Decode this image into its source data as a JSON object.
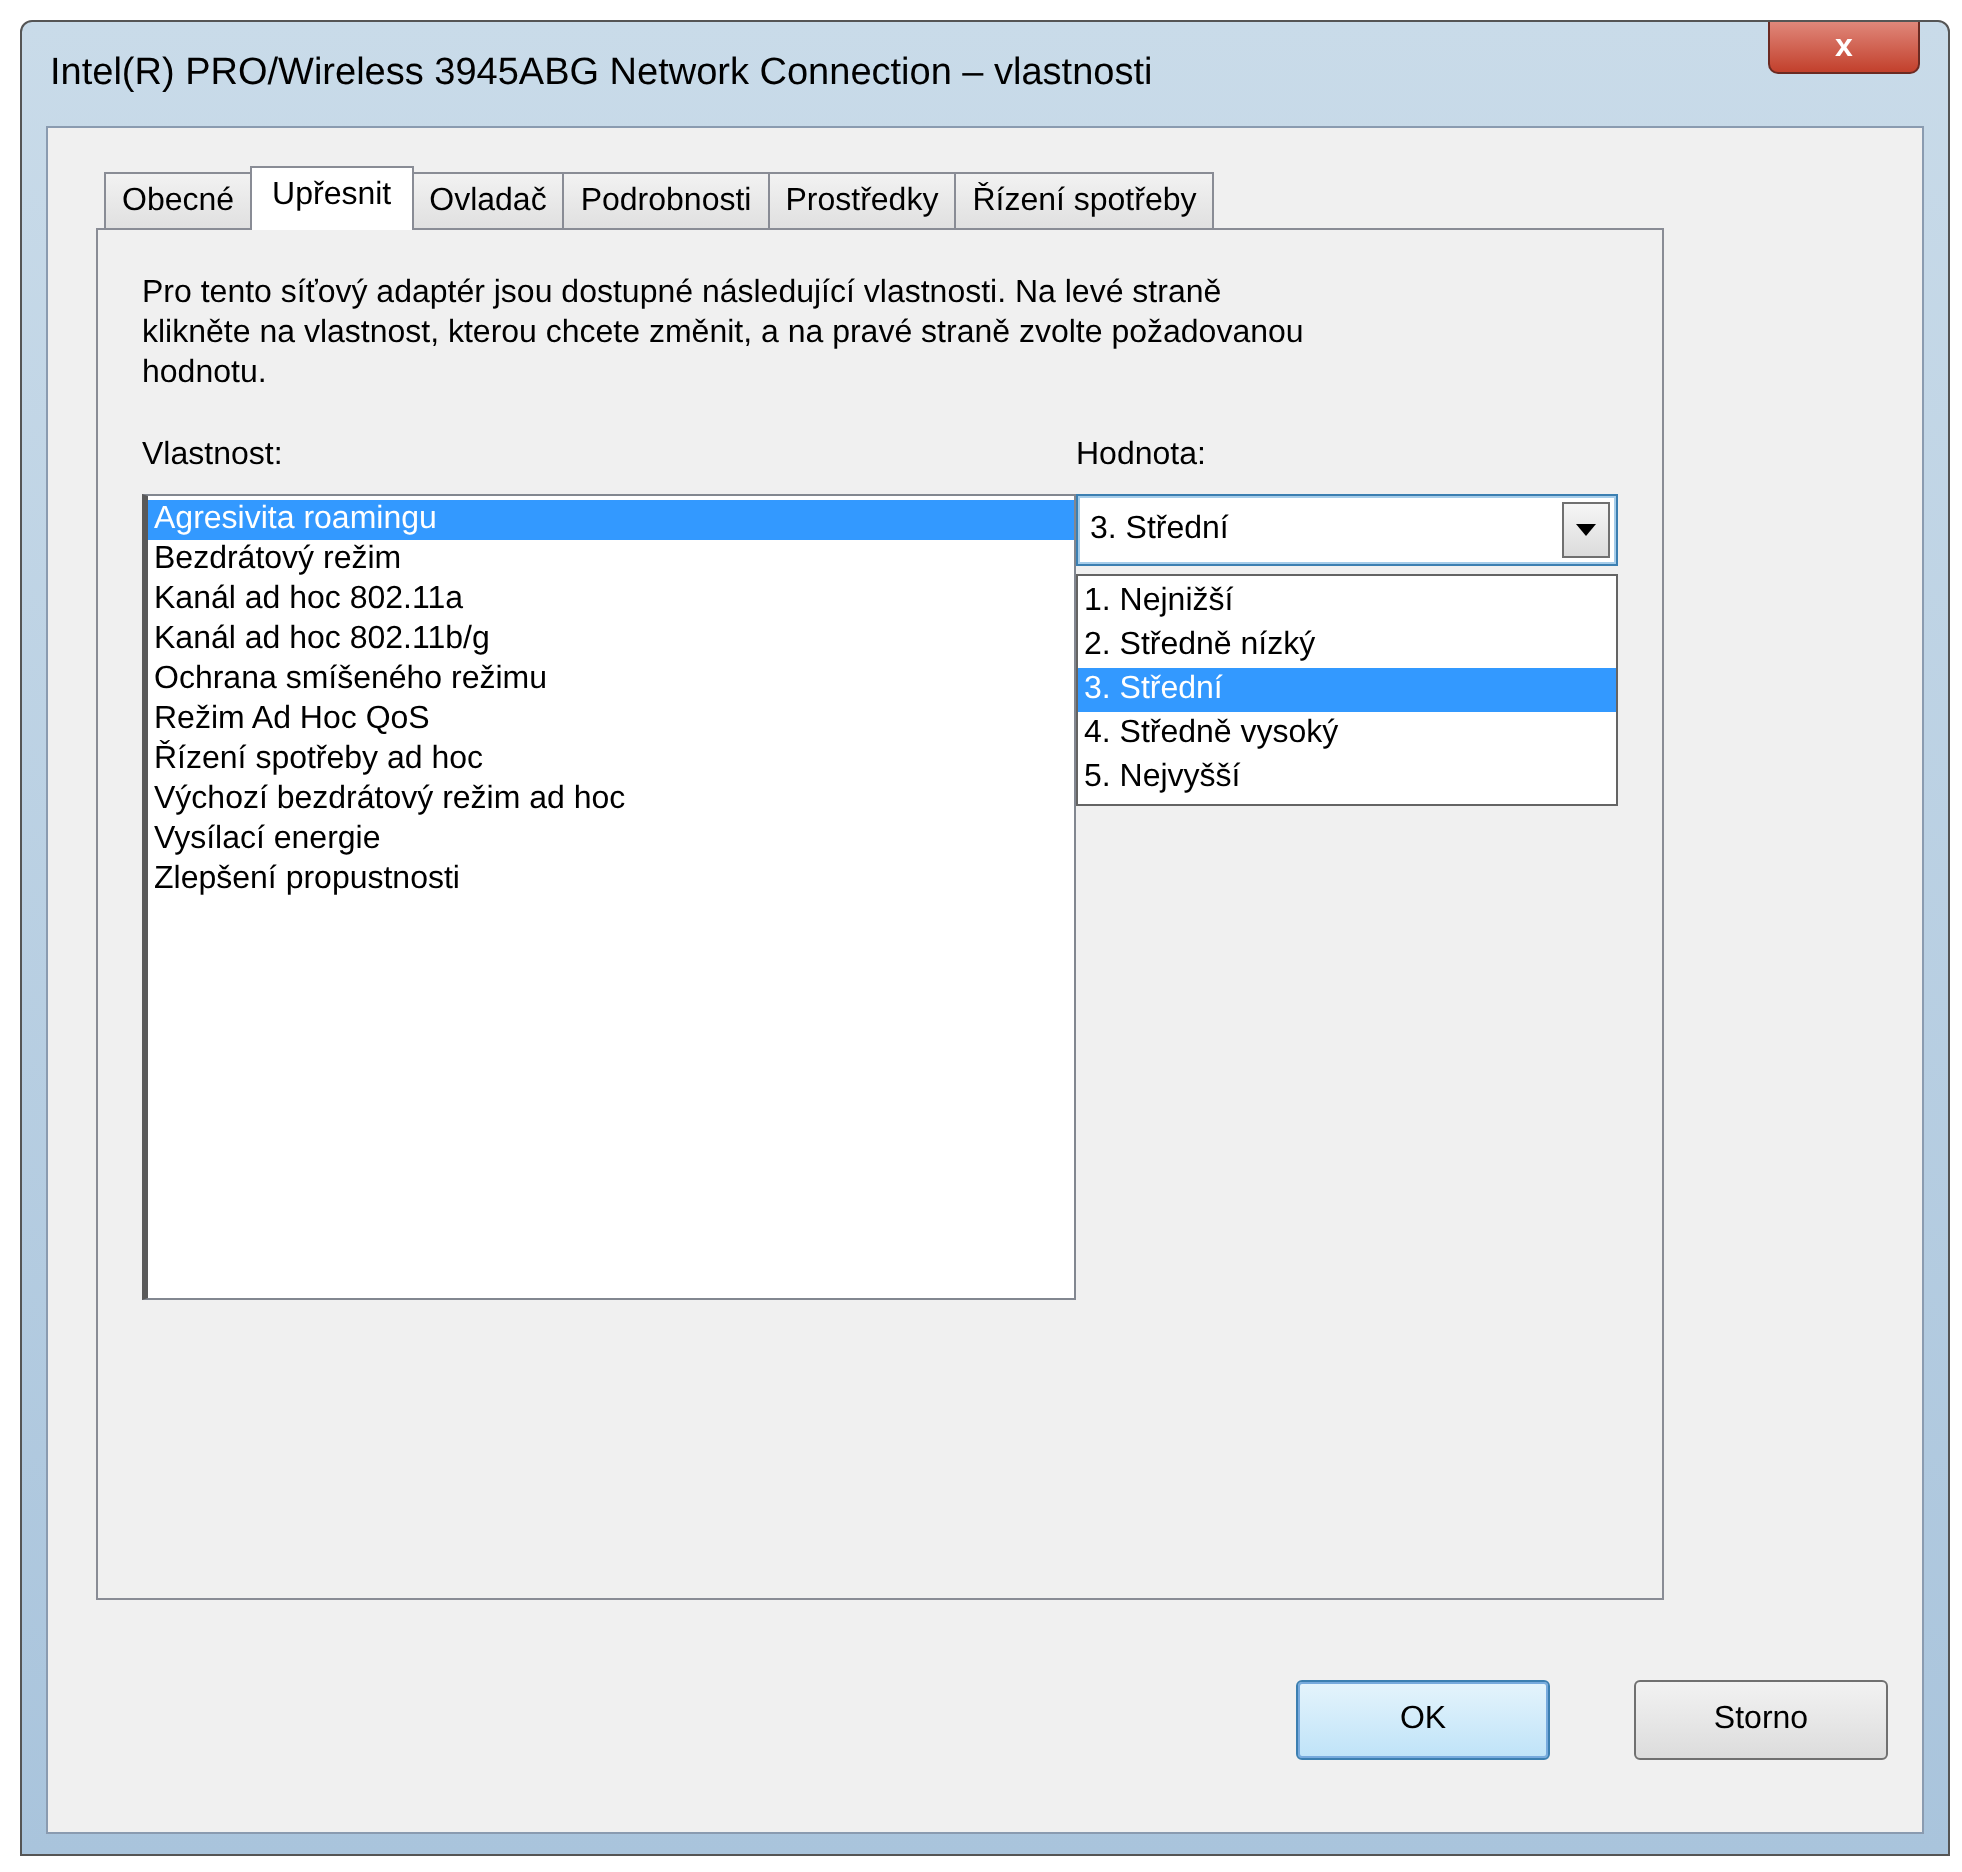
{
  "window": {
    "title": "Intel(R) PRO/Wireless 3945ABG Network Connection – vlastnosti",
    "close": "x"
  },
  "tabs": [
    {
      "label": "Obecné",
      "selected": false
    },
    {
      "label": "Upřesnit",
      "selected": true
    },
    {
      "label": "Ovladač",
      "selected": false
    },
    {
      "label": "Podrobnosti",
      "selected": false
    },
    {
      "label": "Prostředky",
      "selected": false
    },
    {
      "label": "Řízení spotřeby",
      "selected": false
    }
  ],
  "description": "Pro tento síťový adaptér jsou dostupné následující vlastnosti. Na levé straně klikněte na vlastnost, kterou chcete změnit, a na pravé straně zvolte požadovanou hodnotu.",
  "property_label": "Vlastnost:",
  "properties": [
    {
      "label": "Agresivita roamingu",
      "selected": true
    },
    {
      "label": "Bezdrátový režim",
      "selected": false
    },
    {
      "label": "Kanál ad hoc 802.11a",
      "selected": false
    },
    {
      "label": "Kanál ad hoc 802.11b/g",
      "selected": false
    },
    {
      "label": "Ochrana smíšeného režimu",
      "selected": false
    },
    {
      "label": "Režim Ad Hoc QoS",
      "selected": false
    },
    {
      "label": "Řízení spotřeby ad hoc",
      "selected": false
    },
    {
      "label": "Výchozí bezdrátový režim ad hoc",
      "selected": false
    },
    {
      "label": "Vysílací energie",
      "selected": false
    },
    {
      "label": "Zlepšení propustnosti",
      "selected": false
    }
  ],
  "value_label": "Hodnota:",
  "value_combo": {
    "value": "3. Střední",
    "expanded": true
  },
  "value_options": [
    {
      "label": "1. Nejnižší",
      "selected": false
    },
    {
      "label": "2. Středně nízký",
      "selected": false
    },
    {
      "label": "3. Střední",
      "selected": true
    },
    {
      "label": "4. Středně vysoký",
      "selected": false
    },
    {
      "label": "5. Nejvyšší",
      "selected": false
    }
  ],
  "buttons": [
    {
      "label": "OK",
      "default": true
    },
    {
      "label": "Storno",
      "default": false
    }
  ]
}
